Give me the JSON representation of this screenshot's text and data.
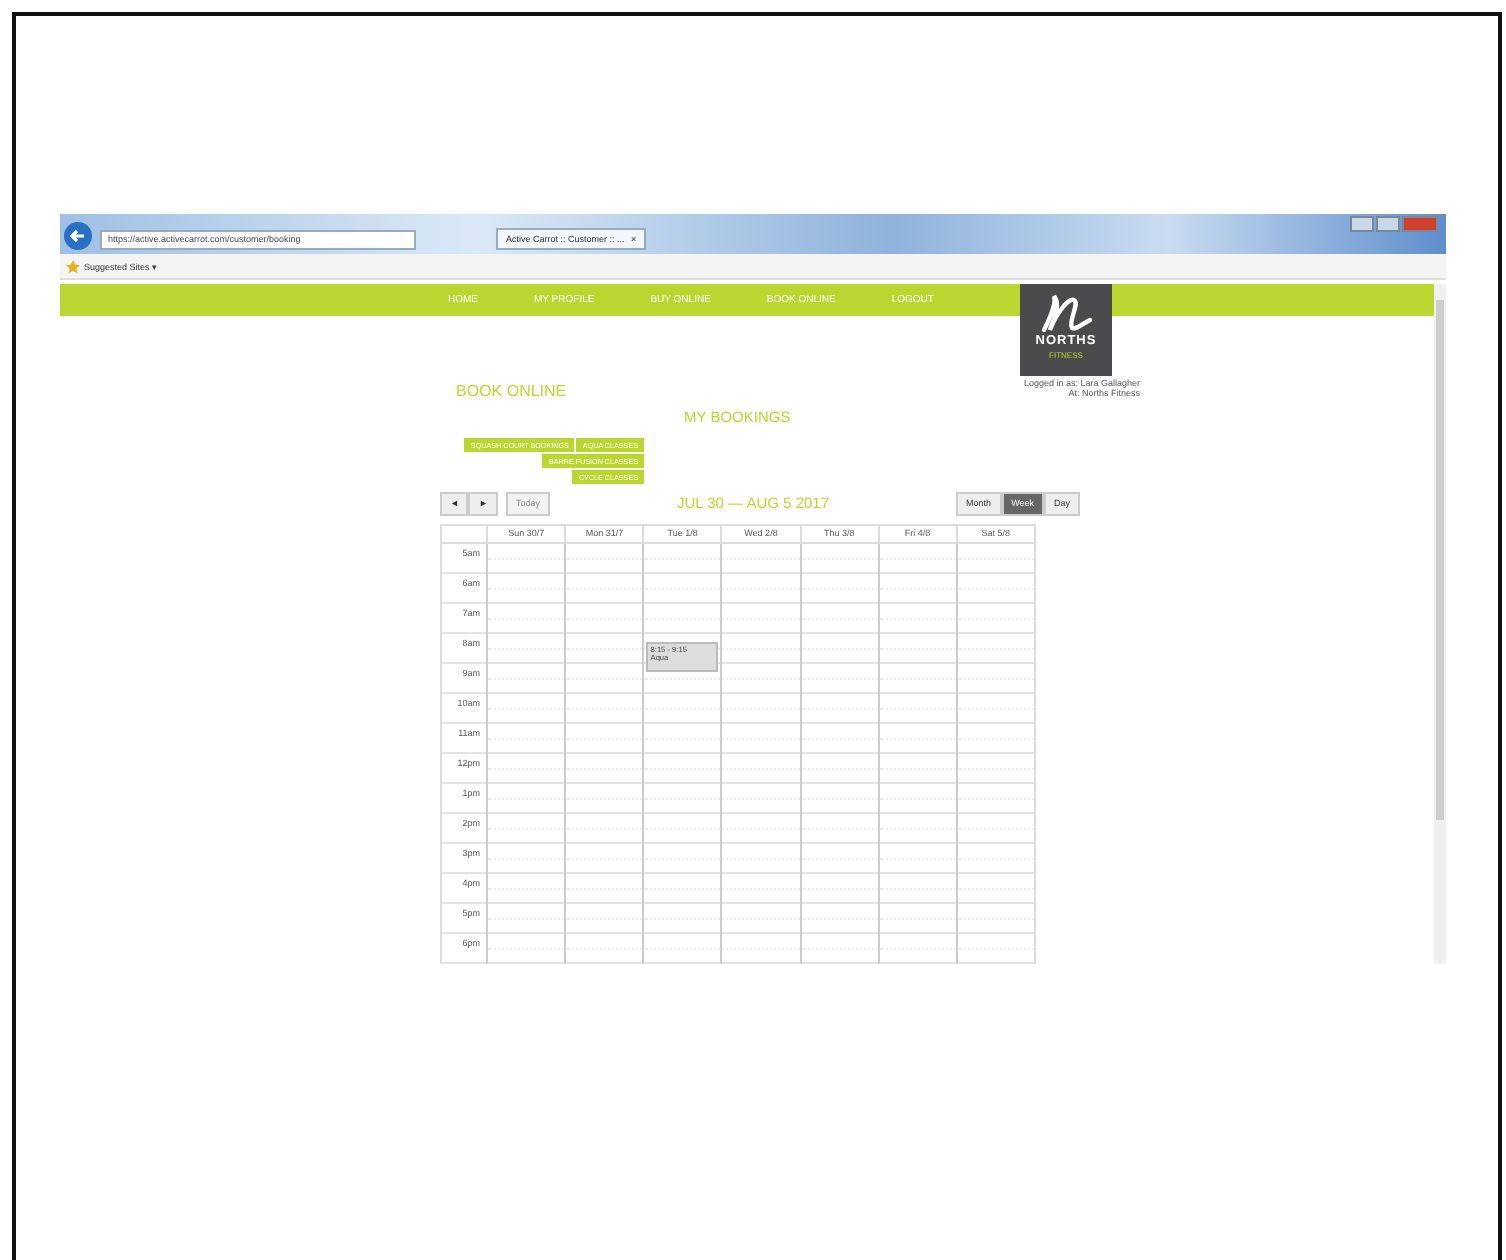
{
  "browser": {
    "url": "https://active.activecarrot.com/customer/booking",
    "tab_title": "Active Carrot :: Customer :: ...",
    "tab_close": "×",
    "favorites": [
      "Suggested Sites ▾"
    ]
  },
  "nav": [
    "HOME",
    "MY PROFILE",
    "BUY ONLINE",
    "BOOK ONLINE",
    "LOGOUT"
  ],
  "logo": {
    "name": "NORTHS",
    "subtitle": "FITNESS"
  },
  "logged_in": [
    "Logged in as: Lara Gallagher",
    "At: Norths Fitness"
  ],
  "page_title": "BOOK ONLINE",
  "section_title": "MY BOOKINGS",
  "category_buttons": [
    [
      "SQUASH COURT BOOKINGS",
      "AQUA CLASSES"
    ],
    [
      "BARRE FUSION CLASSES"
    ],
    [
      "CYCLE CLASSES"
    ]
  ],
  "calendar": {
    "prev": "◄",
    "next": "►",
    "today": {
      "label": "Today",
      "disabled": true
    },
    "title": "JUL 30 — AUG 5 2017",
    "views": [
      {
        "label": "Month",
        "selected": false
      },
      {
        "label": "Week",
        "selected": true
      },
      {
        "label": "Day",
        "selected": false
      }
    ],
    "days": [
      {
        "label": "Sun 30/7"
      },
      {
        "label": "Mon 31/7"
      },
      {
        "label": "Tue 1/8",
        "events": [
          {
            "time": "8:15 - 9:15",
            "title": "Aqua"
          }
        ]
      },
      {
        "label": "Wed 2/8"
      },
      {
        "label": "Thu 3/8"
      },
      {
        "label": "Fri 4/8"
      },
      {
        "label": "Sat 5/8"
      }
    ],
    "hours": [
      "5am",
      "6am",
      "7am",
      "8am",
      "9am",
      "10am",
      "11am",
      "12pm",
      "1pm",
      "2pm",
      "3pm",
      "4pm",
      "5pm",
      "6pm"
    ]
  }
}
